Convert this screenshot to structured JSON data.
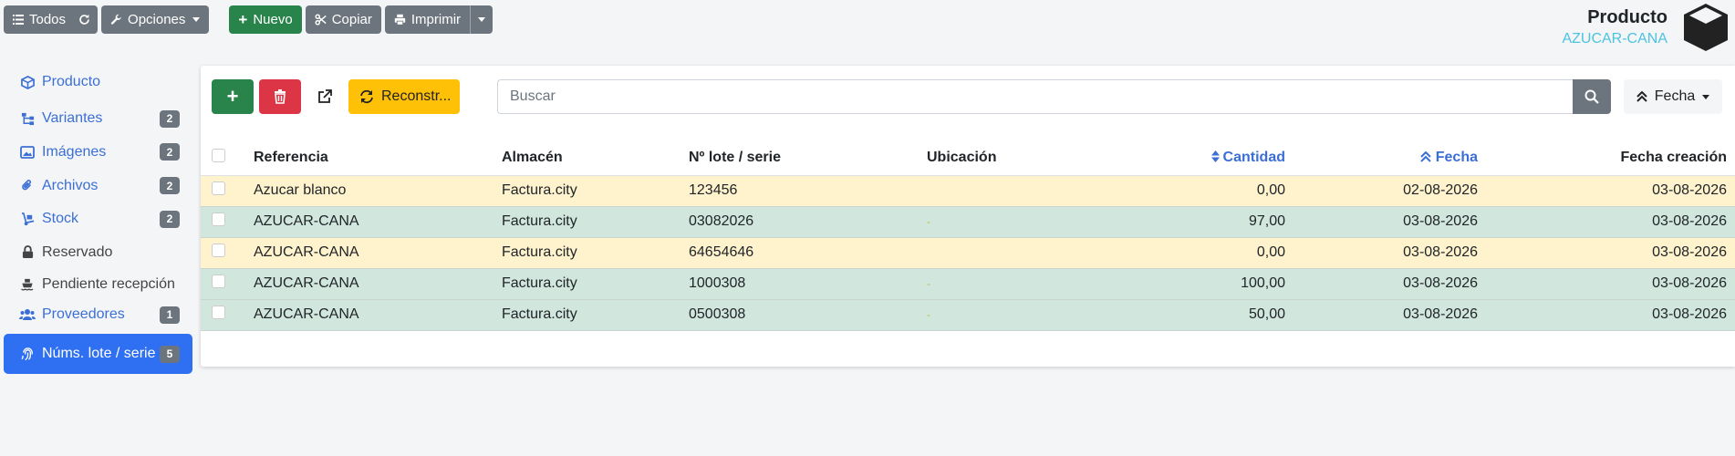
{
  "toolbar": {
    "todos": "Todos",
    "opciones": "Opciones",
    "nuevo": "Nuevo",
    "copiar": "Copiar",
    "imprimir": "Imprimir"
  },
  "header": {
    "title": "Producto",
    "subtitle": "AZUCAR-CANA"
  },
  "sidebar": {
    "items": [
      {
        "label": "Producto",
        "badge": ""
      },
      {
        "label": "Variantes",
        "badge": "2"
      },
      {
        "label": "Imágenes",
        "badge": "2"
      },
      {
        "label": "Archivos",
        "badge": "2"
      },
      {
        "label": "Stock",
        "badge": "2"
      },
      {
        "label": "Reservado",
        "badge": ""
      },
      {
        "label": "Pendiente recepción",
        "badge": ""
      },
      {
        "label": "Proveedores",
        "badge": "1"
      },
      {
        "label": "Núms. lote / serie",
        "badge": "5"
      }
    ]
  },
  "panel": {
    "rebuild_label": "Reconstr...",
    "search_placeholder": "Buscar",
    "sort_label": "Fecha"
  },
  "table": {
    "columns": [
      "Referencia",
      "Almacén",
      "Nº lote / serie",
      "Ubicación",
      "Cantidad",
      "Fecha",
      "Fecha creación"
    ],
    "rows": [
      {
        "ref": "Azucar blanco",
        "almacen": "Factura.city",
        "lote": "123456",
        "ubicacion": "",
        "cantidad": "0,00",
        "fecha": "02-08-2026",
        "creacion": "03-08-2026",
        "status": "warn"
      },
      {
        "ref": "AZUCAR-CANA",
        "almacen": "Factura.city",
        "lote": "03082026",
        "ubicacion": "-",
        "cantidad": "97,00",
        "fecha": "03-08-2026",
        "creacion": "03-08-2026",
        "status": "ok"
      },
      {
        "ref": "AZUCAR-CANA",
        "almacen": "Factura.city",
        "lote": "64654646",
        "ubicacion": "",
        "cantidad": "0,00",
        "fecha": "03-08-2026",
        "creacion": "03-08-2026",
        "status": "warn"
      },
      {
        "ref": "AZUCAR-CANA",
        "almacen": "Factura.city",
        "lote": "1000308",
        "ubicacion": "-",
        "cantidad": "100,00",
        "fecha": "03-08-2026",
        "creacion": "03-08-2026",
        "status": "ok"
      },
      {
        "ref": "AZUCAR-CANA",
        "almacen": "Factura.city",
        "lote": "0500308",
        "ubicacion": "-",
        "cantidad": "50,00",
        "fecha": "03-08-2026",
        "creacion": "03-08-2026",
        "status": "ok"
      }
    ]
  },
  "colors": {
    "link": "#3b6fd6",
    "active": "#2f6ff2",
    "warning_row": "#fff3cd",
    "success_row": "#d1e7dd"
  }
}
